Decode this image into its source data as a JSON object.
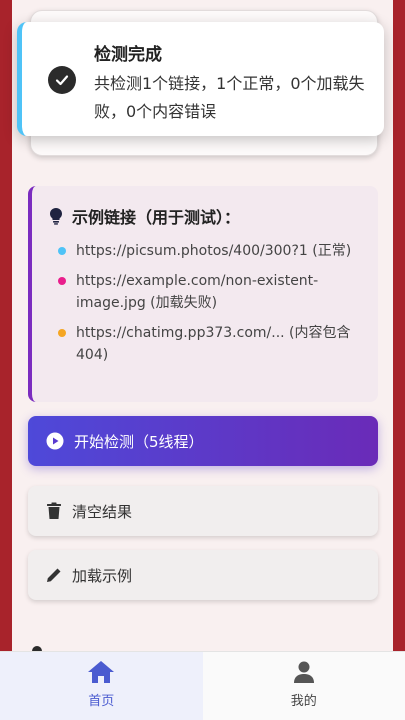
{
  "toast": {
    "title": "检测完成",
    "message": "共检测1个链接，1个正常，0个加载失败，0个内容错误",
    "icon": "check-circle-icon"
  },
  "examples": {
    "title": "示例链接（用于测试）：",
    "icon": "lightbulb-icon",
    "items": [
      {
        "text": "https://picsum.photos/400/300?1 (正常)",
        "color": "#4fc3f7"
      },
      {
        "text": "https://example.com/non-existent-image.jpg (加载失败)",
        "color": "#e91e8c"
      },
      {
        "text": "https://chatimg.pp373.com/... (内容包含404)",
        "color": "#f5a623"
      }
    ]
  },
  "buttons": {
    "start": "开始检测（5线程）",
    "clear": "清空结果",
    "load": "加载示例"
  },
  "tabbar": {
    "home": "首页",
    "mine": "我的"
  },
  "colors": {
    "accent": "#4a5bd0",
    "gradient_start": "#4e49d9",
    "gradient_end": "#6a2bb8",
    "frame": "#a8232b"
  }
}
